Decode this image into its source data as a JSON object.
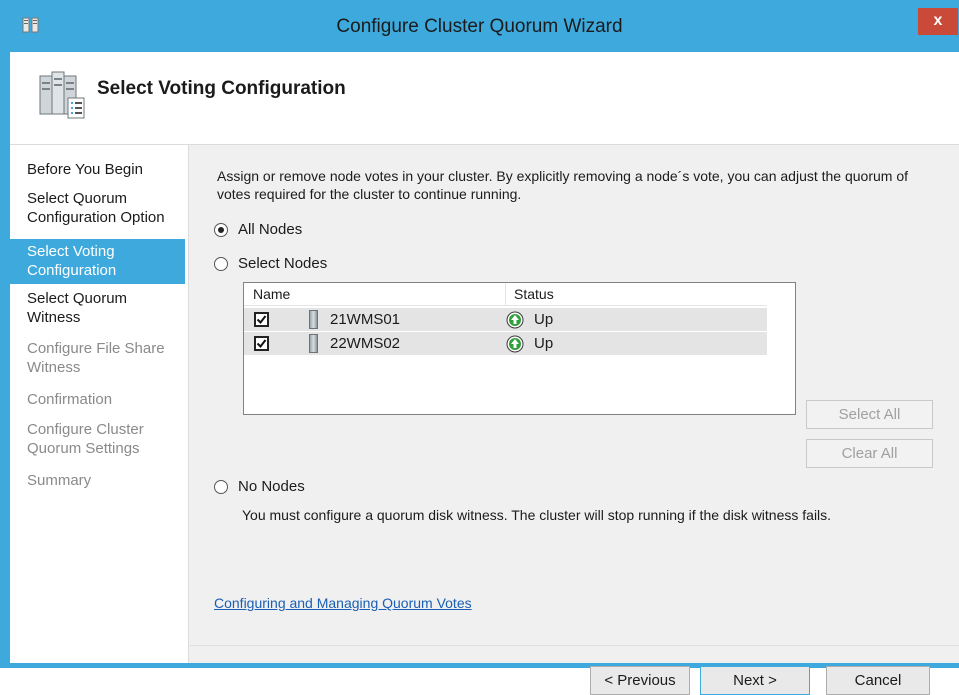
{
  "window": {
    "title": "Configure Cluster Quorum Wizard",
    "close_label": "x",
    "accent_color": "#3da9dc",
    "close_color": "#c94a38"
  },
  "header": {
    "title": "Select Voting Configuration",
    "icon": "cluster-icon"
  },
  "nav": {
    "items": [
      {
        "label": "Before You Begin",
        "state": "normal"
      },
      {
        "label": "Select Quorum Configuration Option",
        "state": "normal"
      },
      {
        "label": "Select Voting Configuration",
        "state": "active"
      },
      {
        "label": "Select Quorum Witness",
        "state": "normal"
      },
      {
        "label": "Configure File Share Witness",
        "state": "disabled"
      },
      {
        "label": "Confirmation",
        "state": "disabled"
      },
      {
        "label": "Configure Cluster Quorum Settings",
        "state": "disabled"
      },
      {
        "label": "Summary",
        "state": "disabled"
      }
    ]
  },
  "content": {
    "description": "Assign or remove node votes in your cluster. By explicitly removing a node´s vote, you can adjust the quorum of votes required for the cluster to continue running.",
    "options": {
      "all_nodes": {
        "label": "All Nodes",
        "checked": true
      },
      "select_nodes": {
        "label": "Select Nodes",
        "checked": false
      },
      "no_nodes": {
        "label": "No Nodes",
        "checked": false
      }
    },
    "grid": {
      "columns": [
        "Name",
        "Status"
      ],
      "rows": [
        {
          "checked": true,
          "name": "21WMS01",
          "status": "Up"
        },
        {
          "checked": true,
          "name": "22WMS02",
          "status": "Up"
        }
      ]
    },
    "select_all_label": "Select All",
    "clear_all_label": "Clear All",
    "no_nodes_note": "You must configure a quorum disk witness. The cluster will stop running if the disk witness fails.",
    "link_text": "Configuring and Managing Quorum Votes"
  },
  "footer": {
    "previous_label": "< Previous",
    "next_label": "Next >",
    "cancel_label": "Cancel"
  }
}
